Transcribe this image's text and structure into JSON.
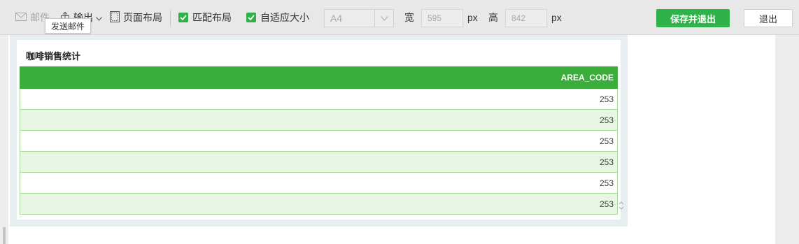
{
  "toolbar": {
    "mail_label": "邮件",
    "export_label": "输出",
    "page_layout_label": "页面布局",
    "match_layout_label": "匹配布局",
    "autofit_label": "自适应大小",
    "paper_size": "A4",
    "width_label": "宽",
    "width_value": "595",
    "width_unit": "px",
    "height_label": "高",
    "height_value": "842",
    "height_unit": "px",
    "save_exit_label": "保存并退出",
    "exit_label": "退出",
    "accent_color": "#2fb24a"
  },
  "tooltip": {
    "text": "发送邮件"
  },
  "report": {
    "title": "咖啡销售统计",
    "header": "AREA_CODE",
    "rows": [
      "253",
      "253",
      "253",
      "253",
      "253",
      "253"
    ]
  }
}
